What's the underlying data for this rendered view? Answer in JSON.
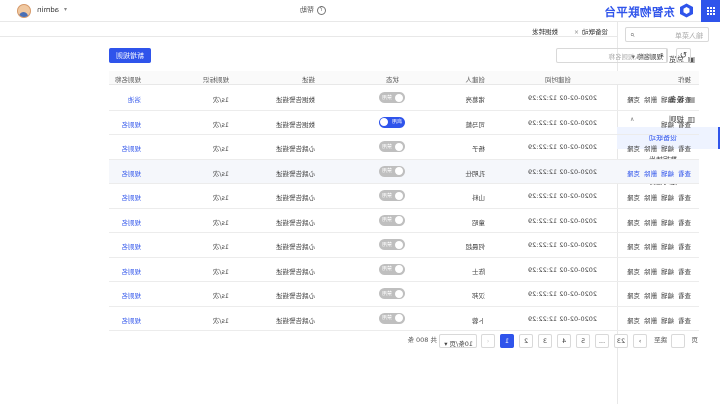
{
  "header": {
    "brand": "东智物联平台",
    "help": "帮助",
    "user": "admin"
  },
  "sidebar": {
    "search_placeholder": "输入菜单",
    "items": [
      {
        "label": "总览",
        "icon": "dashboard-icon"
      },
      {
        "label": "模型",
        "icon": "model-icon"
      },
      {
        "label": "设备",
        "icon": "device-icon"
      },
      {
        "label": "规则",
        "icon": "rule-icon"
      }
    ],
    "sub_items": [
      "设备联动",
      "数据转发",
      "定时任务"
    ]
  },
  "tabs": [
    "设备联动",
    "数据转发"
  ],
  "toolbar": {
    "add_label": "新增规则",
    "select_label": "规则名称",
    "search_placeholder": "请输入规则名称"
  },
  "table": {
    "columns": [
      "规则名称",
      "规则标识",
      "描述",
      "状态",
      "创建人",
      "创建时间",
      "操作"
    ],
    "rows": [
      {
        "name": "浴池",
        "id": "1s/次",
        "desc": "数据告警描述",
        "status": "禁用",
        "on": false,
        "creator": "诸葛亮",
        "time": "2020-02-02 12:22:29",
        "ops": [
          "查看",
          "编辑",
          "删除",
          "克隆"
        ]
      },
      {
        "name": "规则名",
        "id": "1s/次",
        "desc": "数据告警描述",
        "status": "启用",
        "on": true,
        "creator": "司马懿",
        "time": "2020-02-02 12:22:29",
        "ops": [
          "查看",
          "编辑"
        ]
      },
      {
        "name": "规则名",
        "id": "1s/次",
        "desc": "心跳告警描述",
        "status": "禁用",
        "on": false,
        "creator": "杨子",
        "time": "2020-02-02 12:22:29",
        "ops": [
          "查看",
          "编辑",
          "删除",
          "克隆"
        ]
      },
      {
        "name": "规则名",
        "id": "1s/次",
        "desc": "心跳告警描述",
        "status": "禁用",
        "on": false,
        "creator": "孔明仕",
        "time": "2020-02-02 12:22:29",
        "ops": [
          "查看",
          "编辑",
          "删除",
          "克隆"
        ]
      },
      {
        "name": "规则名",
        "id": "1s/次",
        "desc": "心跳告警描述",
        "status": "禁用",
        "on": false,
        "creator": "山料",
        "time": "2020-02-02 12:22:29",
        "ops": [
          "查看",
          "编辑",
          "删除",
          "克隆"
        ]
      },
      {
        "name": "规则名",
        "id": "1s/次",
        "desc": "心跳告警描述",
        "status": "禁用",
        "on": false,
        "creator": "童昭",
        "time": "2020-02-02 12:22:29",
        "ops": [
          "查看",
          "编辑",
          "删除",
          "克隆"
        ]
      },
      {
        "name": "规则名",
        "id": "1s/次",
        "desc": "心跳告警描述",
        "status": "禁用",
        "on": false,
        "creator": "何晨超",
        "time": "2020-02-02 12:22:29",
        "ops": [
          "查看",
          "编辑",
          "删除",
          "克隆"
        ]
      },
      {
        "name": "规则名",
        "id": "1s/次",
        "desc": "心跳告警描述",
        "status": "禁用",
        "on": false,
        "creator": "陈士",
        "time": "2020-02-02 12:22:29",
        "ops": [
          "查看",
          "编辑",
          "删除",
          "克隆"
        ]
      },
      {
        "name": "规则名",
        "id": "1s/次",
        "desc": "心跳告警描述",
        "status": "禁用",
        "on": false,
        "creator": "汉邦",
        "time": "2020-02-02 12:22:29",
        "ops": [
          "查看",
          "编辑",
          "删除",
          "克隆"
        ]
      },
      {
        "name": "规则名",
        "id": "1s/次",
        "desc": "心跳告警描述",
        "status": "禁用",
        "on": false,
        "creator": "卜蓉",
        "time": "2020-02-02 12:22:29",
        "ops": [
          "查看",
          "编辑",
          "删除",
          "克隆"
        ]
      }
    ]
  },
  "pagination": {
    "total": "共 800 条",
    "page_size": "10条/页",
    "pages": [
      "1",
      "2",
      "3",
      "4",
      "5",
      "...",
      "23"
    ],
    "prev": "‹",
    "next": "›",
    "goto": "跳至",
    "page_unit": "页"
  },
  "colors": {
    "primary": "#2f54eb"
  }
}
